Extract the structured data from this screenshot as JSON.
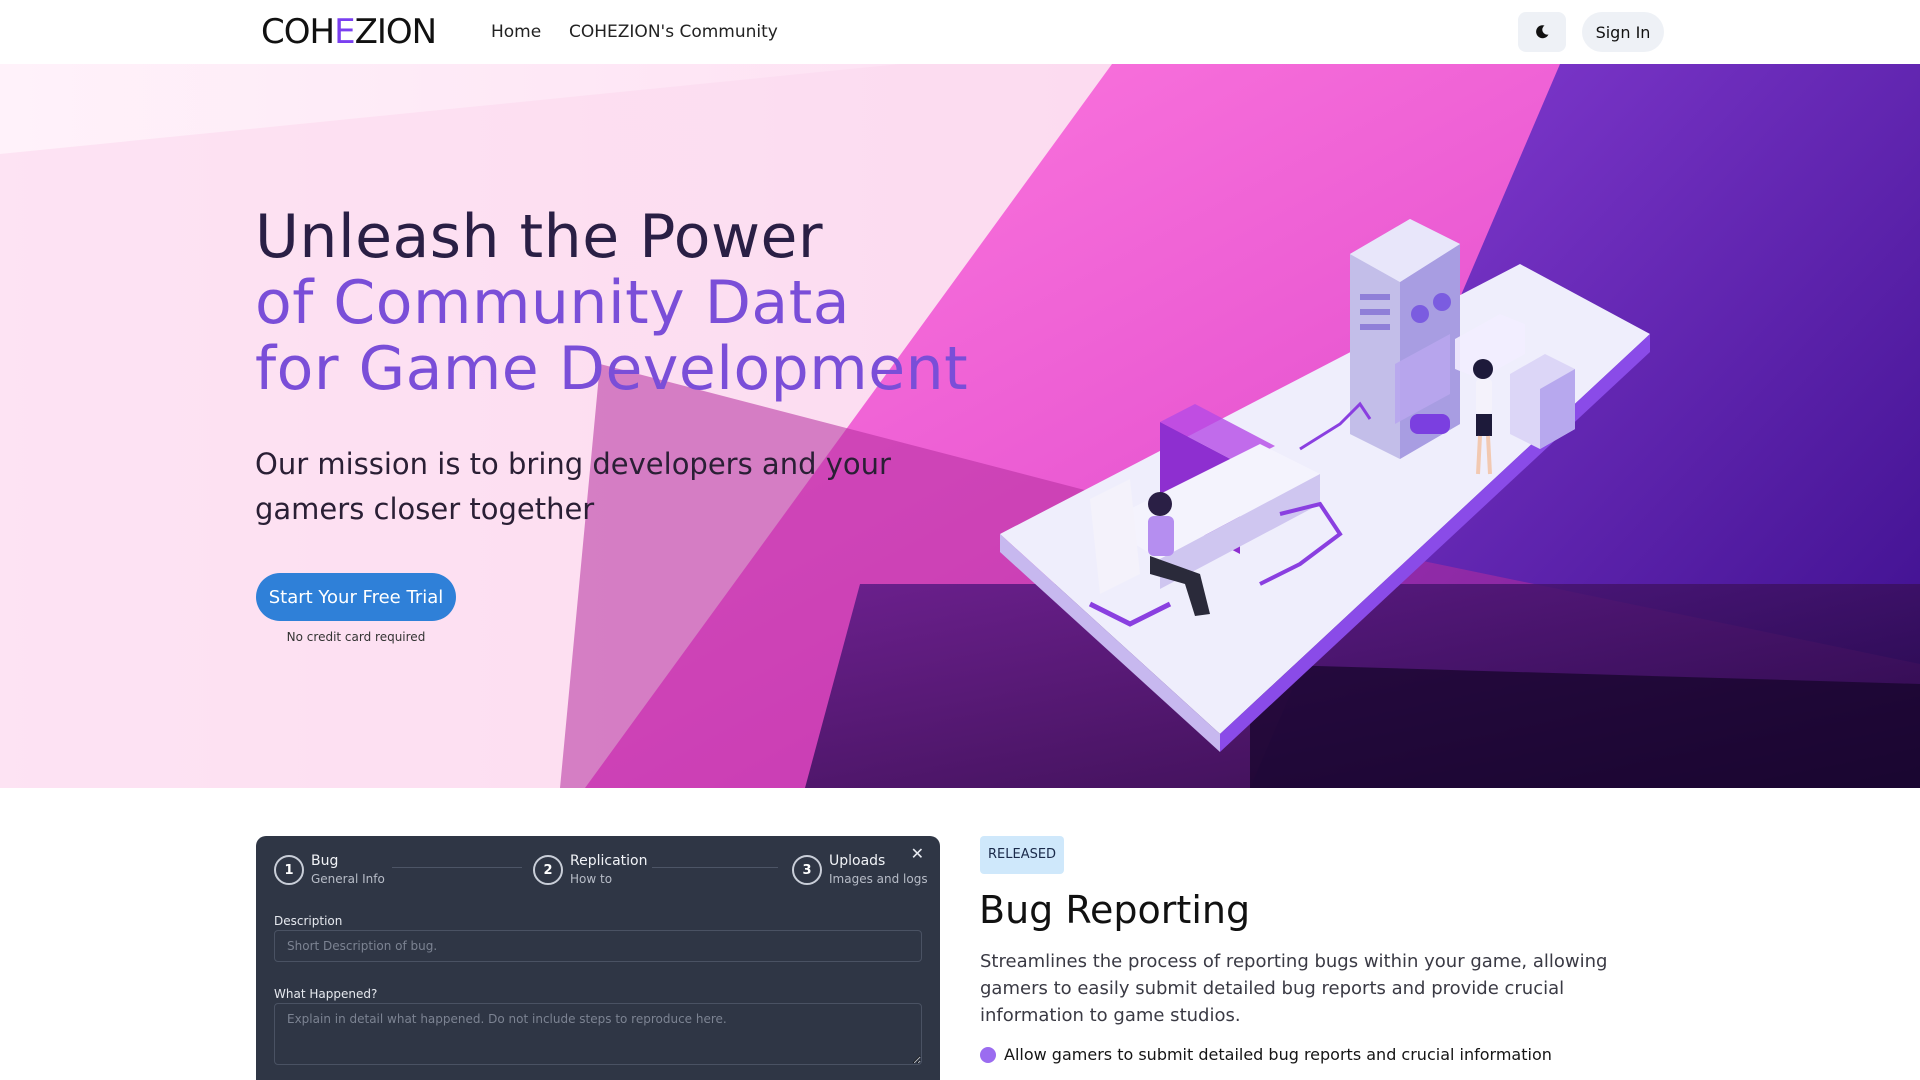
{
  "nav": {
    "logo_pre": "COH",
    "logo_accent": "E",
    "logo_post": "ZION",
    "links": [
      {
        "label": "Home"
      },
      {
        "label": "COHEZION's Community"
      }
    ],
    "sign_in": "Sign In",
    "theme_icon": "moon-icon"
  },
  "hero": {
    "title_line1": "Unleash the Power",
    "title_line2": "of Community Data",
    "title_line3": "for Game Development",
    "subtitle": "Our mission is to bring developers and your gamers closer together",
    "cta": "Start Your Free Trial",
    "cta_note": "No credit card required"
  },
  "form": {
    "steps": [
      {
        "num": "1",
        "title": "Bug",
        "sub": "General Info"
      },
      {
        "num": "2",
        "title": "Replication",
        "sub": "How to"
      },
      {
        "num": "3",
        "title": "Uploads",
        "sub": "Images and logs"
      }
    ],
    "close": "✕",
    "description_label": "Description",
    "description_placeholder": "Short Description of bug.",
    "happened_label": "What Happened?",
    "happened_placeholder": "Explain in detail what happened. Do not include steps to reproduce here."
  },
  "feature": {
    "badge": "RELEASED",
    "title": "Bug Reporting",
    "description": "Streamlines the process of reporting bugs within your game, allowing gamers to easily submit detailed bug reports and provide crucial information to game studios.",
    "bullets": [
      "Allow gamers to submit detailed bug reports and crucial information"
    ]
  },
  "colors": {
    "brand_purple": "#7a4ed8",
    "cta_blue": "#2f80d8",
    "hero_magenta": "#f04fd0",
    "hero_dark_purple": "#3a0d8a",
    "card_dark": "#2f3645",
    "badge_blue": "#cfe8fb"
  }
}
